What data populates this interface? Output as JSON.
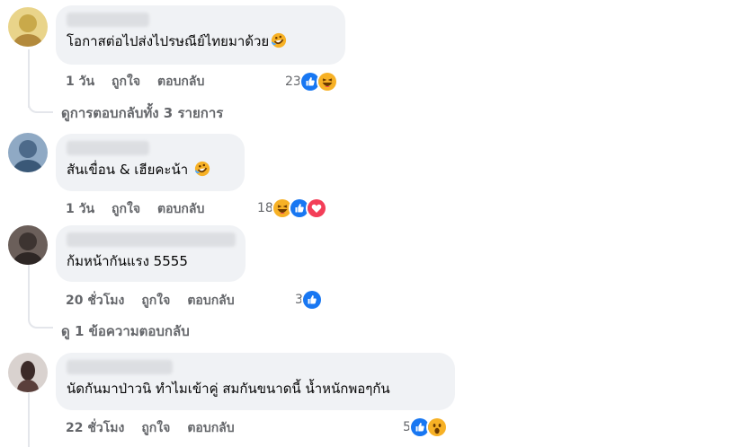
{
  "comments": [
    {
      "text": "โอกาสต่อไปส่งไปรษณีย์ไทยมาด้วย",
      "time": "1 วัน",
      "like": "ถูกใจ",
      "reply": "ตอบกลับ",
      "reaction_count": "23",
      "reactions": [
        "like-icon",
        "haha-icon"
      ]
    },
    {
      "text": "สันเขื่อน & เฮียคะน้า",
      "time": "1 วัน",
      "like": "ถูกใจ",
      "reply": "ตอบกลับ",
      "reaction_count": "18",
      "reactions": [
        "haha-icon",
        "like-icon",
        "love-icon"
      ]
    },
    {
      "text": "ก้มหน้ากันแรง 5555",
      "time": "20 ชั่วโมง",
      "like": "ถูกใจ",
      "reply": "ตอบกลับ",
      "reaction_count": "3",
      "reactions": [
        "like-icon"
      ]
    },
    {
      "text": "นัดกันมาป่าวนิ ทำไมเข้าคู่ สมกันขนาดนี้ น้ำหนักพอๆกัน",
      "time": "22 ชั่วโมง",
      "like": "ถูกใจ",
      "reply": "ตอบกลับ",
      "reaction_count": "5",
      "reactions": [
        "like-icon",
        "wow-icon"
      ]
    }
  ],
  "view_replies": [
    "ดูการตอบกลับทั้ง 3 รายการ",
    "ดู 1 ข้อความตอบกลับ"
  ],
  "colors": {
    "like": "#1877f2",
    "love": "#f33e58",
    "haha": "#f7b125",
    "bubble": "#f0f2f5",
    "meta": "#65676b"
  }
}
